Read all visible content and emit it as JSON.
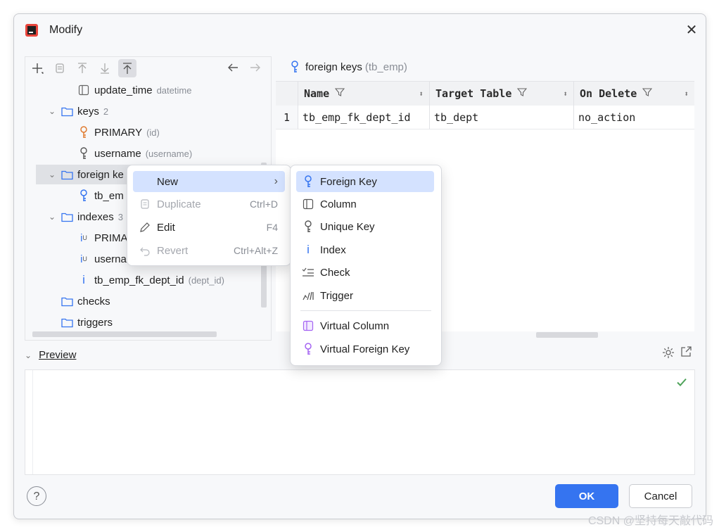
{
  "window": {
    "title": "Modify",
    "close_label": "✕"
  },
  "tree": {
    "rows": [
      {
        "label": "update_time",
        "hint": "datetime"
      },
      {
        "label": "keys",
        "hint": "2"
      },
      {
        "label": "PRIMARY",
        "hint": "(id)"
      },
      {
        "label": "username",
        "hint": "(username)"
      },
      {
        "label": "foreign ke"
      },
      {
        "label": "tb_em"
      },
      {
        "label": "indexes",
        "hint": "3"
      },
      {
        "label": "PRIMA"
      },
      {
        "label": "userna"
      },
      {
        "label": "tb_emp_fk_dept_id",
        "hint": "(dept_id)"
      },
      {
        "label": "checks"
      },
      {
        "label": "triggers"
      }
    ]
  },
  "right": {
    "header": "foreign keys",
    "header_hint": "(tb_emp)",
    "columns": [
      "Name",
      "Target Table",
      "On Delete"
    ],
    "rows": [
      {
        "num": "1",
        "name": "tb_emp_fk_dept_id",
        "target": "tb_dept",
        "on_delete": "no_action"
      }
    ]
  },
  "preview": {
    "label": "Preview"
  },
  "buttons": {
    "ok": "OK",
    "cancel": "Cancel",
    "help": "?"
  },
  "context_menu": {
    "items": [
      {
        "label": "New",
        "shortcut": "›"
      },
      {
        "label": "Duplicate",
        "shortcut": "Ctrl+D"
      },
      {
        "label": "Edit",
        "shortcut": "F4"
      },
      {
        "label": "Revert",
        "shortcut": "Ctrl+Alt+Z"
      }
    ]
  },
  "submenu": {
    "items": [
      {
        "label": "Foreign Key"
      },
      {
        "label": "Column"
      },
      {
        "label": "Unique Key"
      },
      {
        "label": "Index"
      },
      {
        "label": "Check"
      },
      {
        "label": "Trigger"
      },
      {
        "label": "Virtual Column"
      },
      {
        "label": "Virtual Foreign Key"
      }
    ]
  },
  "watermark": "CSDN @坚持每天敲代码",
  "colors": {
    "accent": "#3574f0",
    "key_orange": "#e07a2f",
    "key_blue": "#3574f0",
    "virtual_purple": "#a463f2",
    "check_green": "#4fa35a"
  }
}
